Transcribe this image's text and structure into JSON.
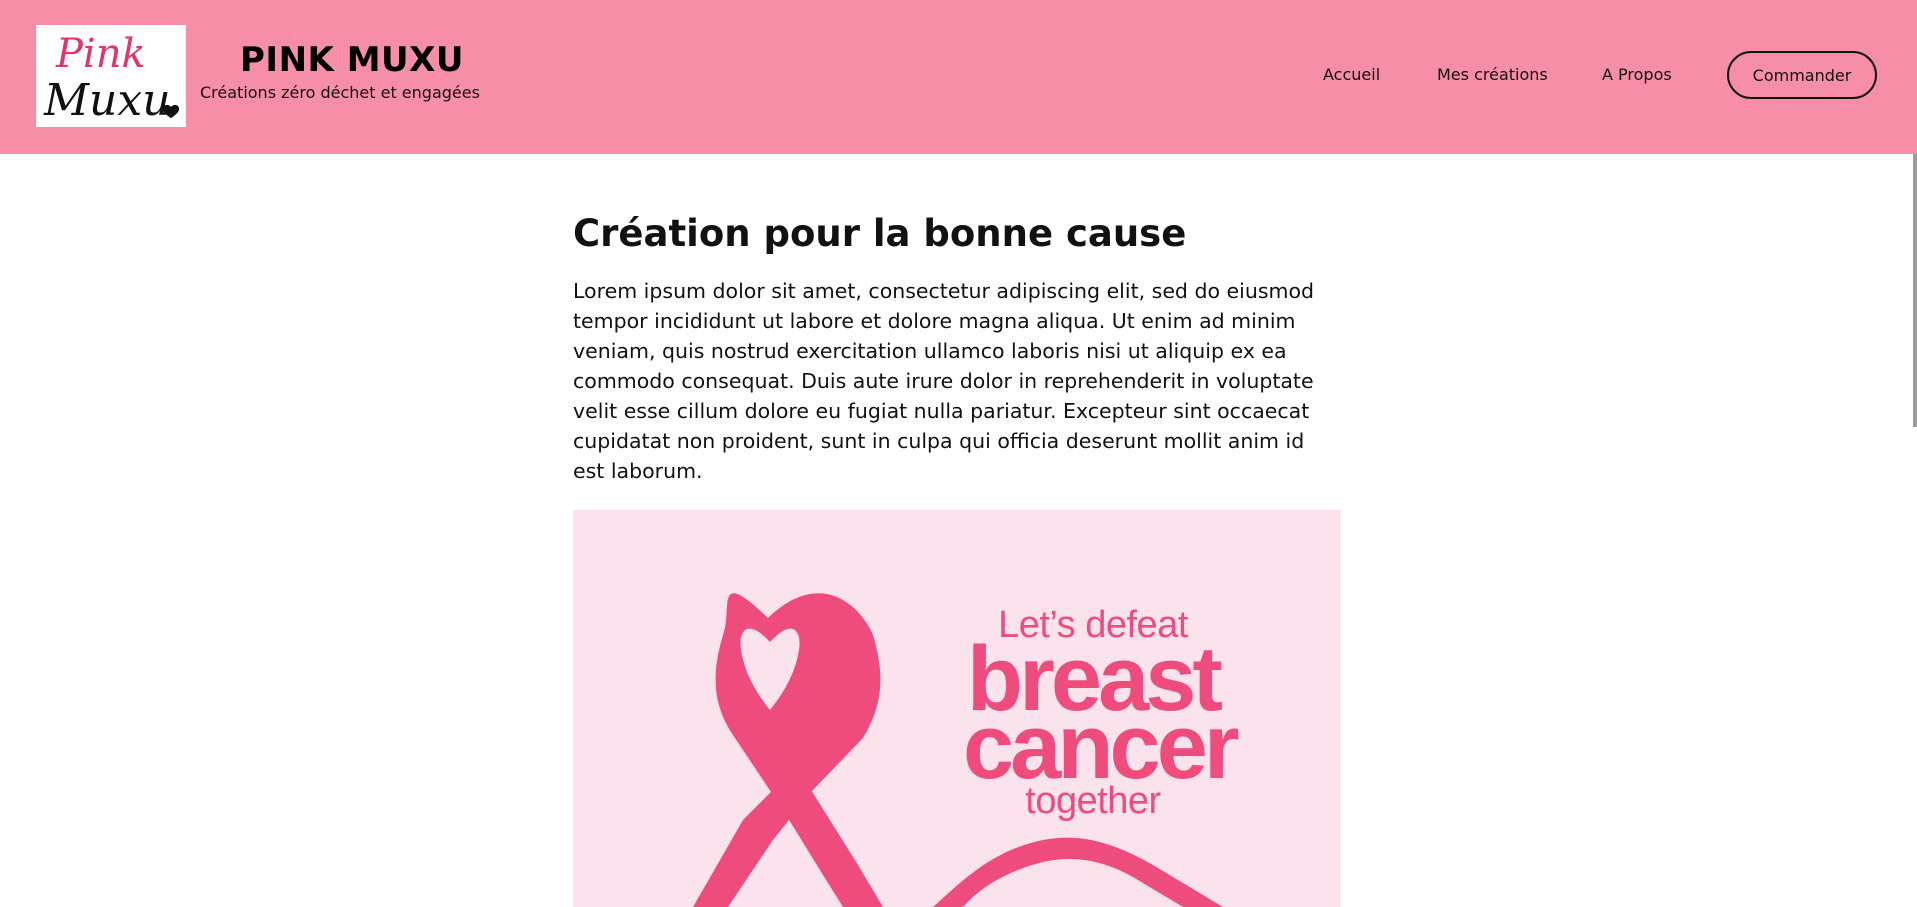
{
  "header": {
    "logo": {
      "line1": "Pink",
      "line2": "Muxu"
    },
    "brand_name": "PINK MUXU",
    "tagline": "Créations zéro déchet et engagées",
    "nav": [
      {
        "label": "Accueil"
      },
      {
        "label": "Mes créations"
      },
      {
        "label": "A Propos"
      }
    ],
    "order_button": "Commander"
  },
  "main": {
    "title": "Création pour la bonne cause",
    "body": "Lorem ipsum dolor sit amet, consectetur adipiscing elit, sed do eiusmod tempor incididunt ut labore et dolore magna aliqua. Ut enim ad minim veniam, quis nostrud exercitation ullamco laboris nisi ut aliquip ex ea commodo consequat. Duis aute irure dolor in reprehenderit in voluptate velit esse cillum dolore eu fugiat nulla pariatur. Excepteur sint occaecat cupidatat non proident, sunt in culpa qui officia deserunt mollit anim id est laborum."
  },
  "hero": {
    "line1": "Let’s defeat",
    "line2": "breast",
    "line3": "cancer",
    "line4": "together"
  },
  "colors": {
    "header_bg": "#f78ea7",
    "hero_bg": "#fae3ec",
    "ribbon": "#ee4c7c",
    "logo_pink": "#e0356d"
  }
}
